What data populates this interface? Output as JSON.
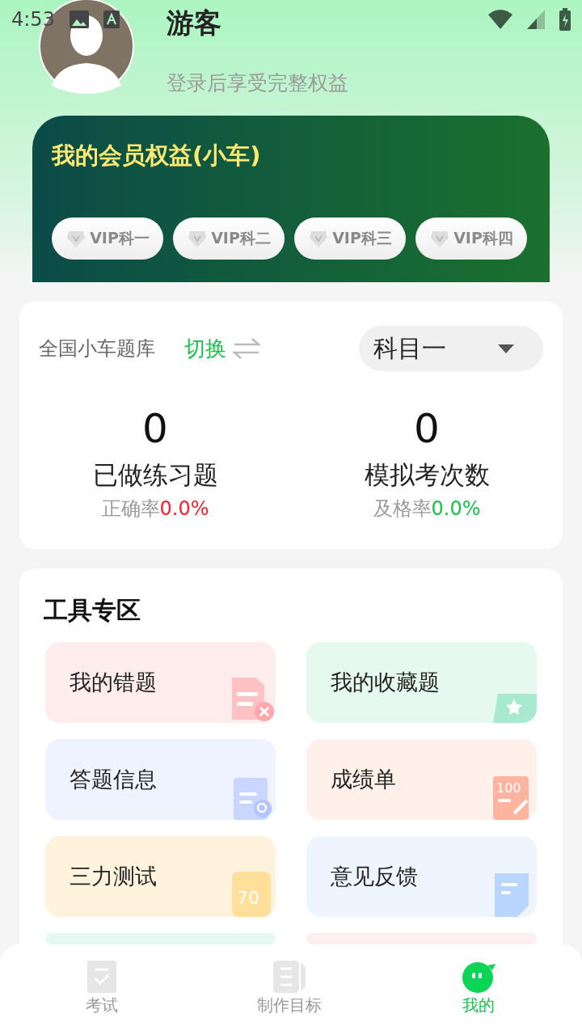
{
  "status_bar": {
    "time": "4:53"
  },
  "profile": {
    "name": "游客",
    "subtitle": "登录后享受完整权益"
  },
  "membership": {
    "title": "我的会员权益(小车)",
    "chips": [
      "VIP科一",
      "VIP科二",
      "VIP科三",
      "VIP科四"
    ]
  },
  "bank": {
    "label": "全国小车题库",
    "switch": "切换",
    "subject": "科目一",
    "stats": [
      {
        "value": "0",
        "label": "已做练习题",
        "rate_label": "正确率",
        "rate": "0.0%",
        "color": "#f5222d"
      },
      {
        "value": "0",
        "label": "模拟考次数",
        "rate_label": "及格率",
        "rate": "0.0%",
        "color": "#17c24a"
      }
    ]
  },
  "tools": {
    "title": "工具专区",
    "items": [
      {
        "label": "我的错题",
        "kind": "wrong",
        "color": "#ffecec"
      },
      {
        "label": "我的收藏题",
        "kind": "star",
        "color": "#e6f9f1"
      },
      {
        "label": "答题信息",
        "kind": "notes",
        "color": "#eff3ff"
      },
      {
        "label": "成绩单",
        "kind": "score",
        "color": "#fff0e9",
        "icon_text": "100"
      },
      {
        "label": "三力测试",
        "kind": "seventy",
        "color": "#fff3dd",
        "icon_text": "70"
      },
      {
        "label": "意见反馈",
        "kind": "feedback",
        "color": "#eef5ff"
      },
      {
        "kind": "none",
        "color": "#e3f9f1"
      },
      {
        "kind": "none",
        "color": "#fdeef2"
      }
    ]
  },
  "tabs": [
    {
      "label": "考试",
      "kind": "exam",
      "selected": false
    },
    {
      "label": "制作目标",
      "kind": "goal",
      "selected": false
    },
    {
      "label": "我的",
      "kind": "me",
      "selected": true
    }
  ]
}
